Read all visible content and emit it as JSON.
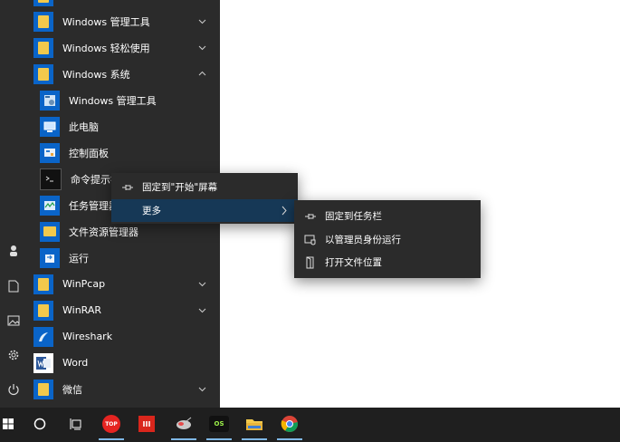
{
  "start_list": {
    "folders": [
      {
        "label": "Windows 管理工具",
        "expanded": false
      },
      {
        "label": "Windows 轻松使用",
        "expanded": false
      },
      {
        "label": "Windows 系统",
        "expanded": true
      }
    ],
    "system_items": [
      {
        "label": "Windows 管理工具",
        "icon": "admin-tools-icon"
      },
      {
        "label": "此电脑",
        "icon": "computer-icon"
      },
      {
        "label": "控制面板",
        "icon": "control-panel-icon"
      },
      {
        "label": "命令提示符",
        "icon": "cmd-icon"
      },
      {
        "label": "任务管理器",
        "icon": "task-manager-icon"
      },
      {
        "label": "文件资源管理器",
        "icon": "folder-icon"
      },
      {
        "label": "运行",
        "icon": "run-icon"
      }
    ],
    "apps": [
      {
        "label": "WinPcap",
        "icon": "folder-icon"
      },
      {
        "label": "WinRAR",
        "icon": "folder-icon"
      },
      {
        "label": "Wireshark",
        "icon": "wireshark-icon"
      },
      {
        "label": "Word",
        "icon": "word-icon"
      },
      {
        "label": "微信",
        "icon": "folder-icon"
      }
    ]
  },
  "context_menu": {
    "items": [
      {
        "label": "固定到\"开始\"屏幕",
        "icon": "pin-icon"
      },
      {
        "label": "更多",
        "icon": "chevron-right-icon"
      }
    ]
  },
  "submenu": {
    "items": [
      {
        "label": "固定到任务栏",
        "icon": "pin-icon"
      },
      {
        "label": "以管理员身份运行",
        "icon": "shield-run-icon"
      },
      {
        "label": "打开文件位置",
        "icon": "file-location-icon"
      }
    ]
  },
  "taskbar": {
    "apps": [
      {
        "name": "top-app",
        "text": "TOP",
        "color": "#e52421"
      },
      {
        "name": "red-app",
        "text": "III",
        "color": "#d9261c"
      },
      {
        "name": "satellite-app",
        "text": "",
        "color": "#b8b8b8"
      },
      {
        "name": "os-app",
        "text": "OS",
        "color": "#1a1a1a"
      },
      {
        "name": "file-explorer",
        "text": "",
        "color": "#f2c94c"
      },
      {
        "name": "chrome",
        "text": "",
        "color": "#4285f4"
      }
    ]
  }
}
